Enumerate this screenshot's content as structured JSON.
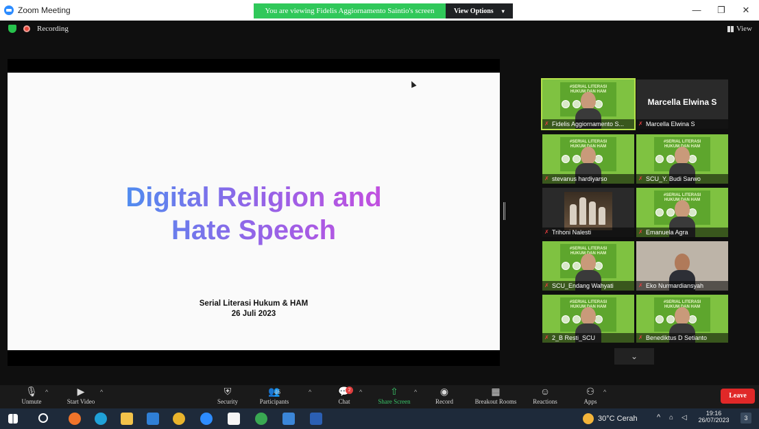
{
  "titlebar": {
    "title": "Zoom Meeting",
    "share_banner": "You are viewing Fidelis Aggiornamento Saintio's screen",
    "view_options": "View Options",
    "minimize": "—",
    "maximize": "❐",
    "close": "✕"
  },
  "meeting": {
    "recording_label": "Recording",
    "view_label": "View"
  },
  "slide": {
    "title_line1": "Digital Religion and",
    "title_line2": "Hate Speech",
    "subtitle_line1": "Serial Literasi Hukum & HAM",
    "subtitle_line2": "26 Juli 2023"
  },
  "gallery": {
    "poster_text": "#SERIAL LITERASI HUKUM DAN HAM",
    "tiles": [
      {
        "name": "Fidelis Aggiornamento S...",
        "style": "green"
      },
      {
        "name": "Marcella Elwina S",
        "big_name": "Marcella Elwina S",
        "style": "dark"
      },
      {
        "name": "stevanus hardiyarso",
        "style": "green"
      },
      {
        "name": "SCU_Y. Budi Sarwo",
        "style": "green"
      },
      {
        "name": "Trihoni Nalesti",
        "style": "dark"
      },
      {
        "name": "Emanuela Agra",
        "style": "green"
      },
      {
        "name": "SCU_Endang Wahyati",
        "style": "green"
      },
      {
        "name": "Eko Nurmardiansyah",
        "style": "photo"
      },
      {
        "name": "2_B Resti_SCU",
        "style": "green"
      },
      {
        "name": "Benediktus D Setianto",
        "style": "green"
      }
    ]
  },
  "toolbar": {
    "unmute": "Unmute",
    "start_video": "Start Video",
    "security": "Security",
    "participants": "Participants",
    "participants_count": "46",
    "chat": "Chat",
    "chat_badge": "2",
    "share_screen": "Share Screen",
    "record": "Record",
    "breakout_rooms": "Breakout Rooms",
    "reactions": "Reactions",
    "apps": "Apps",
    "leave": "Leave"
  },
  "taskbar": {
    "weather": "30°C Cerah",
    "time": "19:16",
    "date": "26/07/2023",
    "notif_count": "3"
  },
  "colors": {
    "accent_green": "#30c85a",
    "leave_red": "#e02828",
    "tile_green": "#7fc241"
  }
}
